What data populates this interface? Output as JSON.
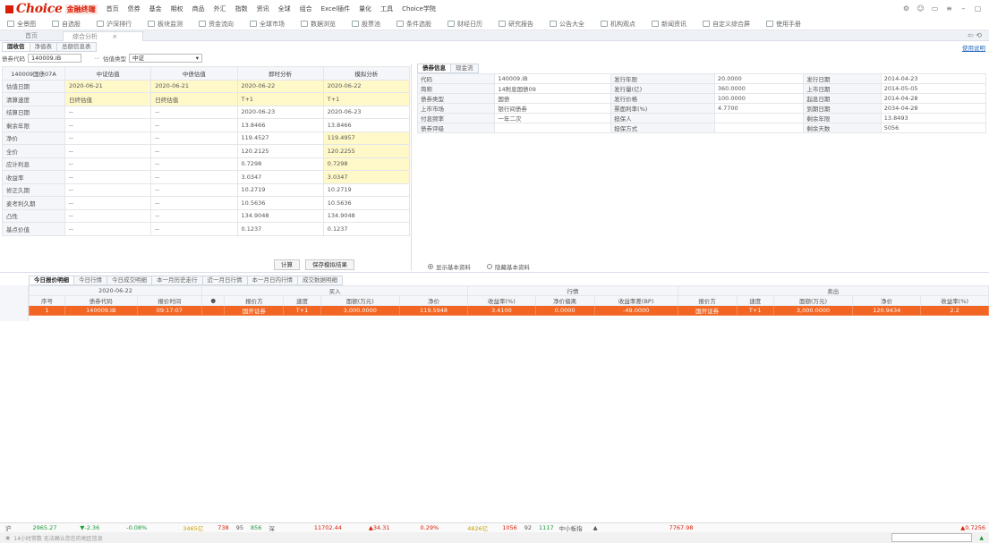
{
  "app": {
    "brand": "Choice",
    "sub": "金融终端"
  },
  "menu": [
    "首页",
    "债券",
    "基金",
    "期权",
    "商品",
    "外汇",
    "指数",
    "资讯",
    "全球",
    "组合",
    "Excel插件",
    "量化",
    "工具",
    "Choice学院"
  ],
  "toolbar": [
    "全景图",
    "自选股",
    "沪深排行",
    "板块监测",
    "资金流向",
    "全球市场",
    "数据浏览",
    "股票池",
    "条件选股",
    "财经日历",
    "研究报告",
    "公告大全",
    "机构观点",
    "新闻资讯",
    "自定义综合屏",
    "使用手册"
  ],
  "tabs": {
    "home": "首页",
    "active": "综合分析"
  },
  "subtabs": [
    "固收信",
    "净值表",
    "总额信息表"
  ],
  "sublink": "使用说明",
  "search": {
    "code_label": "债券代码",
    "code": "140009.IB",
    "type_label": "估值类型",
    "type": "中证"
  },
  "left": {
    "headers": [
      "140009国债07A",
      "中证估值",
      "中债估值",
      "即时分析",
      "模拟分析"
    ],
    "rows": [
      {
        "label": "估值日期",
        "v": [
          "2020-06-21",
          "2020-06-21",
          "2020-06-22",
          "2020-06-22"
        ]
      },
      {
        "label": "清算速度",
        "v": [
          "日终估值",
          "日终估值",
          "T+1",
          "T+1"
        ]
      },
      {
        "label": "结算日期",
        "v": [
          "--",
          "--",
          "2020-06-23",
          "2020-06-23"
        ]
      },
      {
        "label": "剩余年限",
        "v": [
          "--",
          "--",
          "13.8466",
          "13.8466"
        ]
      },
      {
        "label": "净价",
        "v": [
          "--",
          "--",
          "119.4527",
          "119.4957"
        ]
      },
      {
        "label": "全价",
        "v": [
          "--",
          "--",
          "120.2125",
          "120.2255"
        ]
      },
      {
        "label": "应计利息",
        "v": [
          "--",
          "--",
          "0.7298",
          "0.7298"
        ]
      },
      {
        "label": "收益率",
        "v": [
          "--",
          "--",
          "3.0347",
          "3.0347"
        ]
      },
      {
        "label": "修正久期",
        "v": [
          "--",
          "--",
          "10.2719",
          "10.2719"
        ]
      },
      {
        "label": "麦考利久期",
        "v": [
          "--",
          "--",
          "10.5636",
          "10.5636"
        ]
      },
      {
        "label": "凸性",
        "v": [
          "--",
          "--",
          "134.9048",
          "134.9048"
        ]
      },
      {
        "label": "基点价值",
        "v": [
          "--",
          "--",
          "0.1237",
          "0.1237"
        ]
      }
    ],
    "btn_calc": "计算",
    "btn_save": "保存模拟结果"
  },
  "right": {
    "tabs": [
      "债券信息",
      "现金流"
    ],
    "rows": [
      [
        "代码",
        "140009.IB",
        "发行年限",
        "20.0000",
        "发行日期",
        "2014-04-23"
      ],
      [
        "简称",
        "14附息国债09",
        "发行量(亿)",
        "360.0000",
        "上市日期",
        "2014-05-05"
      ],
      [
        "债券类型",
        "国债",
        "发行价格",
        "100.0000",
        "起息日期",
        "2014-04-28"
      ],
      [
        "上市市场",
        "银行间债券",
        "票面利率(%)",
        "4.7700",
        "到期日期",
        "2034-04-28"
      ],
      [
        "付息频率",
        "一年二次",
        "担保人",
        "",
        "剩余年限",
        "13.8493"
      ],
      [
        "债券评级",
        "",
        "担保方式",
        "",
        "剩余天数",
        "5056"
      ]
    ],
    "radio1": "显示基本资料",
    "radio2": "隐藏基本资料"
  },
  "bottom": {
    "tabs": [
      "今日报价明细",
      "今日行情",
      "今日成交明细",
      "本一月历史走行",
      "近一月日行情",
      "本一月日内行情",
      "成交数据明细"
    ],
    "date": "2020-06-22",
    "group_buy": "买入",
    "group_mid": "行情",
    "group_sell": "卖出",
    "headers": [
      "序号",
      "债券代码",
      "报价时间",
      "●",
      "报价方",
      "速度",
      "面额(万元)",
      "净价",
      "收益率(%)",
      "净价偏离",
      "收益率差(BP)",
      "报价方",
      "速度",
      "面额(万元)",
      "净价",
      "收益率(%)"
    ],
    "row": [
      "1",
      "140009.IB",
      "09:17:07",
      "",
      "国开证券",
      "T+1",
      "3,000.0000",
      "119.5948",
      "3.4100",
      "0.0000",
      "-49.0000",
      "国开证券",
      "T+1",
      "3,000.0000",
      "120.9434",
      "2.2"
    ]
  },
  "status": {
    "idx1": "沪",
    "v1": "2965.27",
    "c1": "▼-2.36",
    "p1": "-0.08%",
    "a1": "3465亿",
    "n1": "738",
    "n2": "95",
    "n3": "856",
    "s": "深",
    "v2": "11702.44",
    "c2": "▲34.31",
    "p2": "0.29%",
    "a2": "4826亿",
    "n4": "1056",
    "n5": "92",
    "n6": "1117",
    "lab": "中小板指",
    "v3": "7767.98",
    "p3": "▲0.7256"
  },
  "status2": "14小时常数   无法确认您在的地区信息"
}
